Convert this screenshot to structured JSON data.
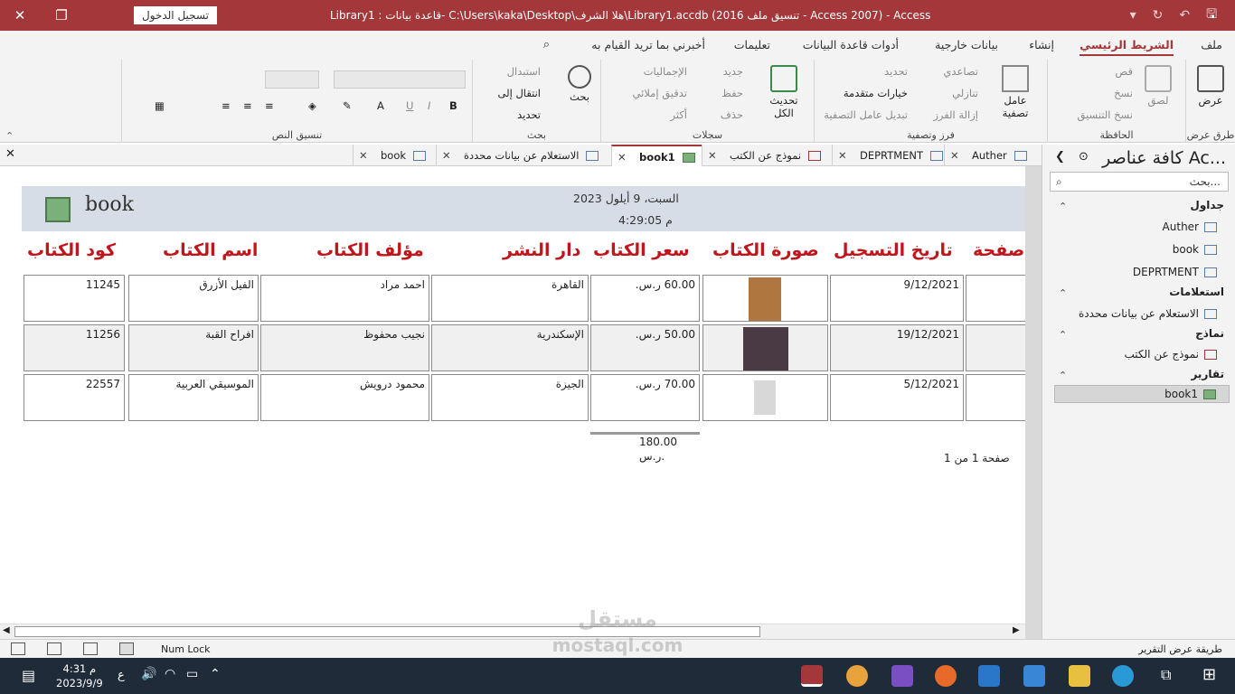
{
  "window": {
    "title": "Library1 : قاعدة بيانات- C:\\Users\\kaka\\Desktop\\هلا الشرف\\Library1.accdb (تنسيق ملف 2016 - Access 2007)  -  Access",
    "signin": "تسجيل الدخول",
    "close": "✕",
    "restore": "❐",
    "minimize": "—"
  },
  "ribbon_tabs": [
    "ملف",
    "الشريط الرئيسي",
    "إنشاء",
    "بيانات خارجية",
    "أدوات قاعدة البيانات",
    "تعليمات",
    "أخبرني بما تريد القيام به"
  ],
  "ribbon": {
    "views": {
      "label": "عرض",
      "group": "طرق عرض"
    },
    "clipboard": {
      "paste": "لصق",
      "cut": "قص",
      "copy": "نسخ",
      "format_painter": "نسخ التنسيق",
      "group": "الحافظة"
    },
    "sort_filter": {
      "filter": "عامل تصفية",
      "ascending": "تصاعدي",
      "descending": "تنازلي",
      "remove_sort": "إزالة الفرز",
      "selection": "تحديد",
      "advanced": "خيارات متقدمة",
      "toggle_filter": "تبديل عامل التصفية",
      "group": "فرز وتصفية"
    },
    "records": {
      "refresh_all": "تحديث الكل",
      "new": "جديد",
      "save": "حفظ",
      "delete": "حذف",
      "totals": "الإجماليات",
      "spelling": "تدقيق إملائي",
      "more": "أكثر",
      "group": "سجلات"
    },
    "find": {
      "find": "بحث",
      "replace": "استبدال",
      "goto": "انتقال إلى",
      "select": "تحديد",
      "group": "بحث"
    },
    "text_format": {
      "group": "تنسيق النص"
    }
  },
  "doc_tabs": [
    {
      "label": "Auther",
      "active": false
    },
    {
      "label": "DEPRTMENT",
      "active": false
    },
    {
      "label": "نموذج عن الكتب",
      "active": false
    },
    {
      "label": "book1",
      "active": true
    },
    {
      "label": "الاستعلام عن بيانات محددة",
      "active": false
    },
    {
      "label": "book",
      "active": false
    }
  ],
  "report": {
    "title": "book",
    "date": "السبت، 9 أيلول 2023",
    "time": "4:29:05 م",
    "headers": [
      "صفحة",
      "تاريخ التسجيل",
      "صورة الكتاب",
      "سعر الكتاب",
      "دار النشر",
      "مؤلف الكتاب",
      "اسم الكتاب",
      "كود الكتاب"
    ],
    "rows": [
      {
        "date": "9/12/2021",
        "price": "60.00 ر.س.",
        "publisher": "القاهرة",
        "author": "احمد مراد",
        "name": "الفيل الأزرق",
        "code": "11245"
      },
      {
        "date": "19/12/2021",
        "price": "50.00 ر.س.",
        "publisher": "الإسكندرية",
        "author": "نجيب محفوظ",
        "name": "افراح القبة",
        "code": "11256"
      },
      {
        "date": "5/12/2021",
        "price": "70.00 ر.س.",
        "publisher": "الجيزة",
        "author": "محمود درويش",
        "name": "الموسيقي العربية",
        "code": "22557"
      }
    ],
    "total": "180.00 ر.س.",
    "page_info": "صفحة 1 من 1"
  },
  "nav_pane": {
    "title": "كافة عناصر Ac...",
    "search_placeholder": "بحث...",
    "sections": [
      {
        "label": "جداول",
        "items": [
          "Auther",
          "book",
          "DEPRTMENT"
        ]
      },
      {
        "label": "استعلامات",
        "items": [
          "الاستعلام عن بيانات محددة"
        ]
      },
      {
        "label": "نماذج",
        "items": [
          "نموذج عن الكتب"
        ]
      },
      {
        "label": "تقارير",
        "items": [
          "book1"
        ]
      }
    ]
  },
  "status": {
    "left": "Num Lock",
    "right": "طريقة عرض التقرير"
  },
  "taskbar": {
    "time": "4:31 م",
    "date": "2023/9/9",
    "lang": "ع"
  },
  "watermark": {
    "line1": "مستقل",
    "line2": "mostaql.com"
  }
}
